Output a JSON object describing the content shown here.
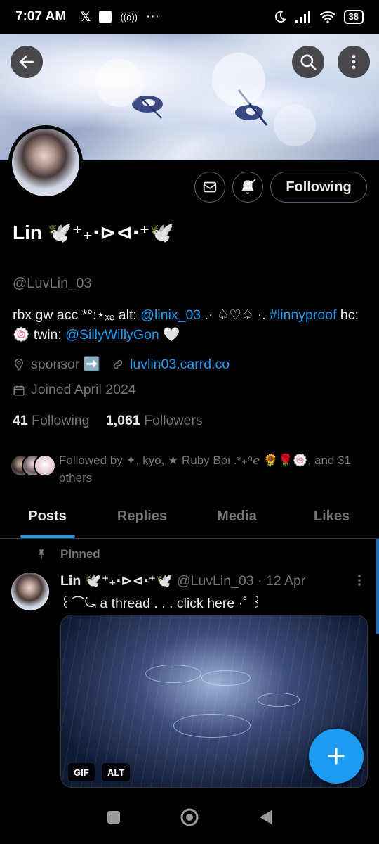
{
  "status_bar": {
    "time": "7:07 AM",
    "x_logo": "𝕏",
    "radio_symbol": "((o))",
    "more": "···",
    "battery": "38"
  },
  "profile": {
    "name": "Lin 🕊️⁺₊‧⊳⊲‧⁺🕊️",
    "handle": "@LuvLin_03",
    "bio": {
      "t1": "rbx gw acc *°:⋆ₓₒ alt: ",
      "alt_link": "@linix_03",
      "t2": " .· ♤♡♤ ·. ",
      "hashtag": "#linnyproof",
      "t3": " hc: 🍥 twin: ",
      "twin_link": "@SillyWillyGon",
      "t4": " 🤍"
    },
    "location": "sponsor ➡️",
    "website": "luvlin03.carrd.co",
    "joined": "Joined April 2024",
    "following_count": "41",
    "following_label": "Following",
    "followers_count": "1,061",
    "followers_label": "Followers",
    "followed_by": "Followed by ✦, kyo, ★ Ruby Boi .*₊⁹ℯ 🌻🌹🍥, and 31 others"
  },
  "actions": {
    "following_button": "Following"
  },
  "tabs": [
    {
      "label": "Posts",
      "active": true
    },
    {
      "label": "Replies",
      "active": false
    },
    {
      "label": "Media",
      "active": false
    },
    {
      "label": "Likes",
      "active": false
    }
  ],
  "pinned_post": {
    "pinned_label": "Pinned",
    "author_name": "Lin 🕊️⁺₊‧⊳⊲‧⁺🕊️",
    "author_handle": "@LuvLin_03",
    "date": "12 Apr",
    "separator": "·",
    "text": "꒰⌒⤿ a thread . . . click here ·˚ ꒱",
    "gif_badge": "GIF",
    "alt_badge": "ALT"
  },
  "colors": {
    "accent": "#1d9bf0",
    "background": "#000000",
    "muted_text": "#71767b"
  }
}
